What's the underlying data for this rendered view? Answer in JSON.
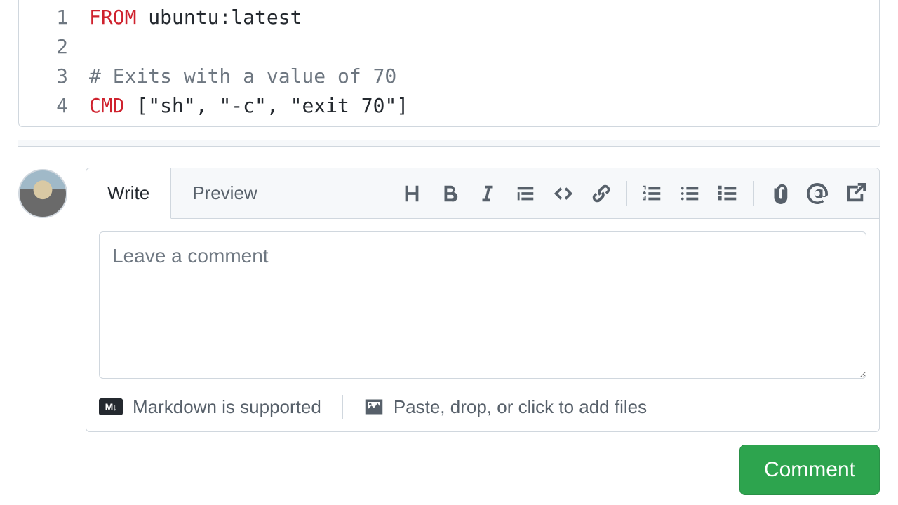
{
  "code": {
    "lines": [
      {
        "num": "1",
        "tokens": [
          {
            "cls": "kw-from",
            "text": "FROM"
          },
          {
            "cls": "",
            "text": " ubuntu:latest"
          }
        ]
      },
      {
        "num": "2",
        "tokens": []
      },
      {
        "num": "3",
        "tokens": [
          {
            "cls": "comment",
            "text": "# Exits with a value of 70"
          }
        ]
      },
      {
        "num": "4",
        "tokens": [
          {
            "cls": "kw-cmd",
            "text": "CMD"
          },
          {
            "cls": "",
            "text": " [\"sh\", \"-c\", \"exit 70\"]"
          }
        ]
      }
    ]
  },
  "composer": {
    "tabs": {
      "write": "Write",
      "preview": "Preview"
    },
    "placeholder": "Leave a comment",
    "footer": {
      "markdown": "Markdown is supported",
      "upload": "Paste, drop, or click to add files"
    },
    "submit": "Comment",
    "toolbar_icons": [
      "heading-icon",
      "bold-icon",
      "italic-icon",
      "quote-icon",
      "code-icon",
      "link-icon",
      "numbered-list-icon",
      "bulleted-list-icon",
      "task-list-icon",
      "attach-icon",
      "mention-icon",
      "reference-icon"
    ]
  }
}
